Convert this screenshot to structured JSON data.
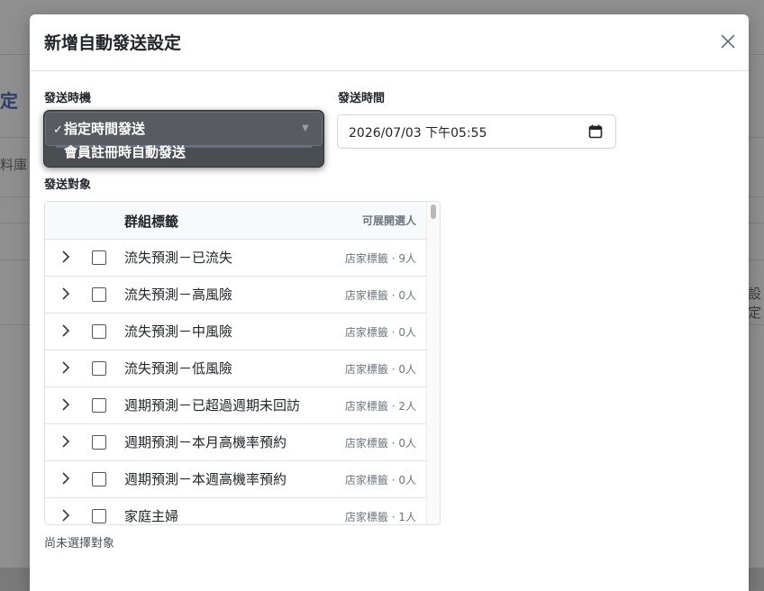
{
  "background": {
    "title_fragment": "定",
    "left_fragment": "料庫",
    "right_fragment": "設定"
  },
  "modal": {
    "title": "新增自動發送設定",
    "close_icon": "close-icon"
  },
  "send_timing": {
    "label": "發送時機",
    "options": [
      {
        "label": "指定時間發送",
        "selected": true
      },
      {
        "label": "會員註冊時自動發送",
        "selected": false
      }
    ],
    "check_mark": "✓"
  },
  "send_time": {
    "label": "發送時間",
    "value": "2026/07/03 下午05:55",
    "icon": "calendar-icon"
  },
  "send_target": {
    "label": "發送對象",
    "table": {
      "col_name": "群組標籤",
      "col_count": "可展開選人",
      "rows": [
        {
          "label": "流失預測－已流失",
          "meta": "店家標籤 · 9人"
        },
        {
          "label": "流失預測－高風險",
          "meta": "店家標籤 · 0人"
        },
        {
          "label": "流失預測－中風險",
          "meta": "店家標籤 · 0人"
        },
        {
          "label": "流失預測－低風險",
          "meta": "店家標籤 · 0人"
        },
        {
          "label": "週期預測－已超過週期未回訪",
          "meta": "店家標籤 · 2人"
        },
        {
          "label": "週期預測－本月高機率預約",
          "meta": "店家標籤 · 0人"
        },
        {
          "label": "週期預測－本週高機率預約",
          "meta": "店家標籤 · 0人"
        },
        {
          "label": "家庭主婦",
          "meta": "店家標籤 · 1人"
        }
      ]
    },
    "status": "尚未選擇對象"
  }
}
